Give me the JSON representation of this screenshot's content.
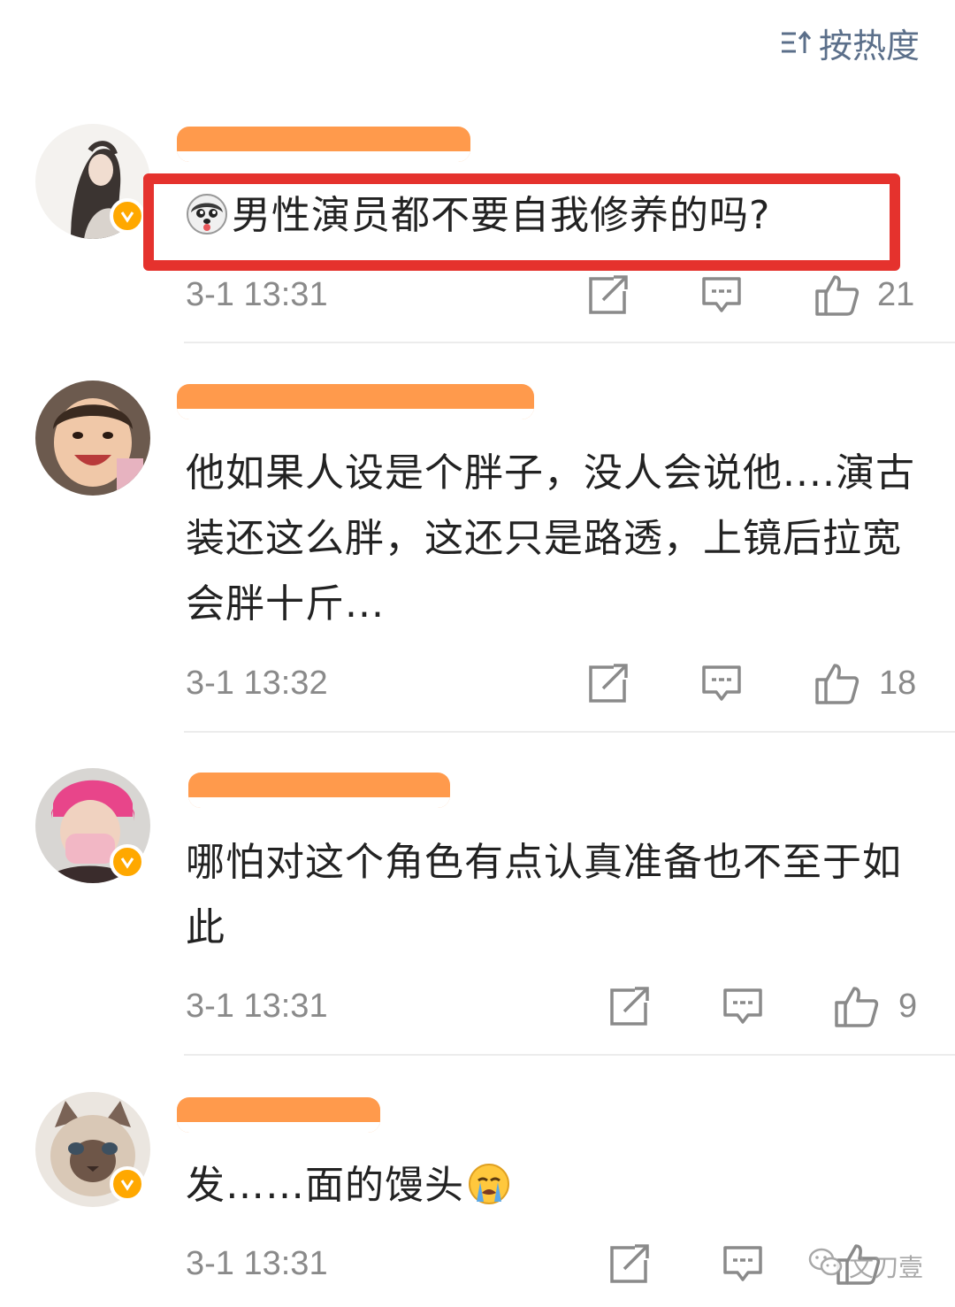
{
  "sort": {
    "label": "按热度",
    "icon": "sort-icon"
  },
  "comments": [
    {
      "username": "••••••••",
      "emoji": "husky-emoji",
      "text": "男性演员都不要自我修养的吗?",
      "timestamp": "3-1 13:31",
      "likes": "21",
      "verified": true
    },
    {
      "username": "••••••••••",
      "text": "他如果人设是个胖子，没人会说他....演古装还这么胖，这还只是路透，上镜后拉宽会胖十斤...",
      "timestamp": "3-1 13:32",
      "likes": "18",
      "verified": false
    },
    {
      "username": "•••••••",
      "text": "哪怕对这个角色有点认真准备也不至于如此",
      "timestamp": "3-1 13:31",
      "likes": "9",
      "verified": true
    },
    {
      "username": "•••••",
      "text": "发……面的馒头",
      "emoji_after": "crying-emoji",
      "timestamp": "3-1 13:31",
      "likes": "",
      "verified": true
    }
  ],
  "watermark": {
    "text": "文刀壹",
    "icon": "wechat-icon"
  },
  "colors": {
    "verified_badge": "#ffa800",
    "redaction": "#ff9a4c",
    "highlight_box": "#e5322d",
    "sort_text": "#5b6f8a",
    "meta_text": "#8a8a8a"
  }
}
